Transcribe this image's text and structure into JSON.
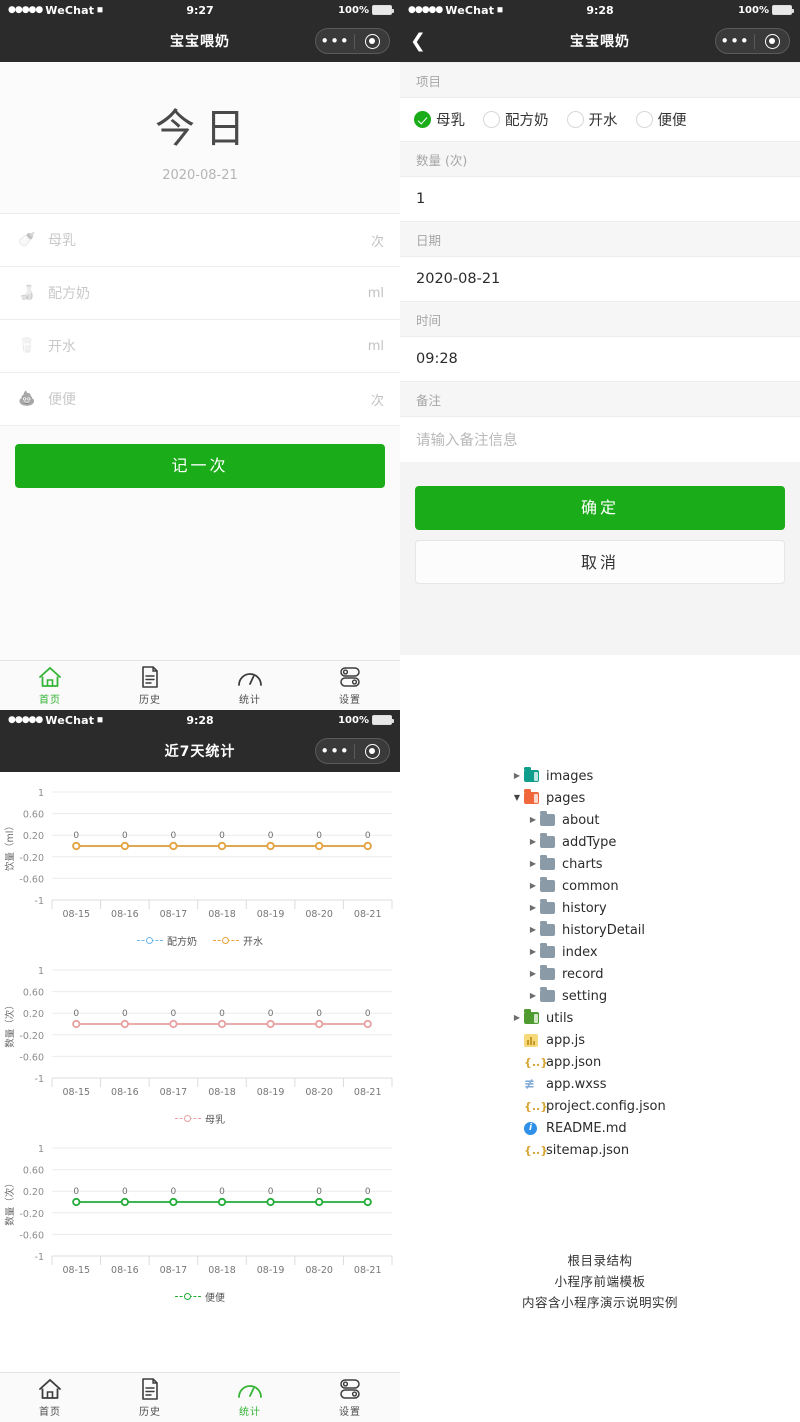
{
  "panels": {
    "home": {
      "status": {
        "carrier": "WeChat",
        "dots": "●●●●●",
        "wifi": "◂",
        "time": "9:27",
        "battery": "100%"
      },
      "nav": {
        "title": "宝宝喂奶",
        "capsule_dots": "•••"
      },
      "today": {
        "title": "今日",
        "date": "2020-08-21"
      },
      "rows": [
        {
          "icon": "breast-milk-icon",
          "glyph": "🍼",
          "label": "母乳",
          "unit": "次"
        },
        {
          "icon": "formula-milk-icon",
          "glyph": "🍶",
          "label": "配方奶",
          "unit": "ml"
        },
        {
          "icon": "water-icon",
          "glyph": "🥛",
          "label": "开水",
          "unit": "ml"
        },
        {
          "icon": "poop-icon",
          "glyph": "💩",
          "label": "便便",
          "unit": "次"
        }
      ],
      "record_button": "记一次",
      "tabs": [
        {
          "name": "home",
          "label": "首页",
          "active": true
        },
        {
          "name": "history",
          "label": "历史",
          "active": false
        },
        {
          "name": "statistics",
          "label": "统计",
          "active": false
        },
        {
          "name": "settings",
          "label": "设置",
          "active": false
        }
      ]
    },
    "form": {
      "status": {
        "carrier": "WeChat",
        "dots": "●●●●●",
        "wifi": "◂",
        "time": "9:28",
        "battery": "100%"
      },
      "nav": {
        "back": "❮",
        "title": "宝宝喂奶",
        "capsule_dots": "•••"
      },
      "fields": {
        "project_label": "项目",
        "options": [
          {
            "label": "母乳",
            "checked": true
          },
          {
            "label": "配方奶",
            "checked": false
          },
          {
            "label": "开水",
            "checked": false
          },
          {
            "label": "便便",
            "checked": false
          }
        ],
        "quantity_label": "数量 (次)",
        "quantity_value": "1",
        "date_label": "日期",
        "date_value": "2020-08-21",
        "time_label": "时间",
        "time_value": "09:28",
        "note_label": "备注",
        "note_placeholder": "请输入备注信息"
      },
      "confirm_button": "确定",
      "cancel_button": "取消"
    },
    "charts": {
      "status": {
        "carrier": "WeChat",
        "dots": "●●●●●",
        "wifi": "◂",
        "time": "9:28",
        "battery": "100%"
      },
      "nav": {
        "title": "近7天统计",
        "capsule_dots": "•••"
      },
      "tabs": [
        {
          "name": "home",
          "label": "首页",
          "active": false
        },
        {
          "name": "history",
          "label": "历史",
          "active": false
        },
        {
          "name": "statistics",
          "label": "统计",
          "active": true
        },
        {
          "name": "settings",
          "label": "设置",
          "active": false
        }
      ]
    },
    "tree": {
      "annotation": [
        "根目录结构",
        "小程序前端模板",
        "内容含小程序演示说明实例"
      ],
      "items": [
        {
          "name": "images",
          "type": "folder",
          "color": "teal",
          "indent": 1,
          "arrow": "collapsed"
        },
        {
          "name": "pages",
          "type": "folder",
          "color": "orange",
          "indent": 1,
          "arrow": "expanded"
        },
        {
          "name": "about",
          "type": "folder",
          "color": "grey",
          "indent": 2,
          "arrow": "collapsed"
        },
        {
          "name": "addType",
          "type": "folder",
          "color": "grey",
          "indent": 2,
          "arrow": "collapsed"
        },
        {
          "name": "charts",
          "type": "folder",
          "color": "grey",
          "indent": 2,
          "arrow": "collapsed"
        },
        {
          "name": "common",
          "type": "folder",
          "color": "grey",
          "indent": 2,
          "arrow": "collapsed"
        },
        {
          "name": "history",
          "type": "folder",
          "color": "grey",
          "indent": 2,
          "arrow": "collapsed"
        },
        {
          "name": "historyDetail",
          "type": "folder",
          "color": "grey",
          "indent": 2,
          "arrow": "collapsed"
        },
        {
          "name": "index",
          "type": "folder",
          "color": "grey",
          "indent": 2,
          "arrow": "collapsed"
        },
        {
          "name": "record",
          "type": "folder",
          "color": "grey",
          "indent": 2,
          "arrow": "collapsed"
        },
        {
          "name": "setting",
          "type": "folder",
          "color": "grey",
          "indent": 2,
          "arrow": "collapsed"
        },
        {
          "name": "utils",
          "type": "folder",
          "color": "green",
          "indent": 1,
          "arrow": "collapsed"
        },
        {
          "name": "app.js",
          "type": "js",
          "indent": 1,
          "arrow": "none"
        },
        {
          "name": "app.json",
          "type": "json",
          "indent": 1,
          "arrow": "none"
        },
        {
          "name": "app.wxss",
          "type": "wxss",
          "indent": 1,
          "arrow": "none"
        },
        {
          "name": "project.config.json",
          "type": "json",
          "indent": 1,
          "arrow": "none"
        },
        {
          "name": "README.md",
          "type": "md",
          "indent": 1,
          "arrow": "none"
        },
        {
          "name": "sitemap.json",
          "type": "json",
          "indent": 1,
          "arrow": "none"
        }
      ]
    }
  },
  "colors": {
    "wechat_green": "#1aad19",
    "tab_active_green": "#34b334",
    "series_formula": "#6cb7e8",
    "series_water": "#e8a33d",
    "series_breastmilk": "#e8a0a0",
    "series_poop": "#22ac38",
    "navbar": "#2b2b2b"
  },
  "chart_data": [
    {
      "type": "line",
      "title": "",
      "xlabel": "",
      "ylabel": "饮量（ml）",
      "categories": [
        "08-15",
        "08-16",
        "08-17",
        "08-18",
        "08-19",
        "08-20",
        "08-21"
      ],
      "yticks": [
        "1",
        "0.60",
        "0.20",
        "-0.20",
        "-0.60",
        "-1"
      ],
      "ylim": [
        -1,
        1
      ],
      "grid": true,
      "legend_position": "bottom",
      "point_labels": [
        "0",
        "0",
        "0",
        "0",
        "0",
        "0",
        "0"
      ],
      "series": [
        {
          "name": "配方奶",
          "color": "#6cb7e8",
          "values": [
            0,
            0,
            0,
            0,
            0,
            0,
            0
          ]
        },
        {
          "name": "开水",
          "color": "#e8a33d",
          "values": [
            0,
            0,
            0,
            0,
            0,
            0,
            0
          ]
        }
      ]
    },
    {
      "type": "line",
      "title": "",
      "xlabel": "",
      "ylabel": "数量（次）",
      "categories": [
        "08-15",
        "08-16",
        "08-17",
        "08-18",
        "08-19",
        "08-20",
        "08-21"
      ],
      "yticks": [
        "1",
        "0.60",
        "0.20",
        "-0.20",
        "-0.60",
        "-1"
      ],
      "ylim": [
        -1,
        1
      ],
      "grid": true,
      "legend_position": "bottom",
      "point_labels": [
        "0",
        "0",
        "0",
        "0",
        "0",
        "0",
        "0"
      ],
      "series": [
        {
          "name": "母乳",
          "color": "#e8a0a0",
          "values": [
            0,
            0,
            0,
            0,
            0,
            0,
            0
          ]
        }
      ]
    },
    {
      "type": "line",
      "title": "",
      "xlabel": "",
      "ylabel": "数量（次）",
      "categories": [
        "08-15",
        "08-16",
        "08-17",
        "08-18",
        "08-19",
        "08-20",
        "08-21"
      ],
      "yticks": [
        "1",
        "0.60",
        "0.20",
        "-0.20",
        "-0.60",
        "-1"
      ],
      "ylim": [
        -1,
        1
      ],
      "grid": true,
      "legend_position": "bottom",
      "point_labels": [
        "0",
        "0",
        "0",
        "0",
        "0",
        "0",
        "0"
      ],
      "series": [
        {
          "name": "便便",
          "color": "#22ac38",
          "values": [
            0,
            0,
            0,
            0,
            0,
            0,
            0
          ]
        }
      ]
    }
  ]
}
